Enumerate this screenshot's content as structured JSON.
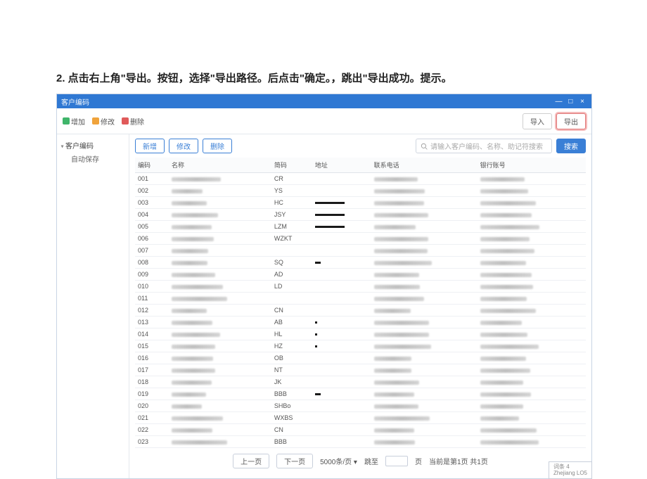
{
  "instruction": "2. 点击右上角\"导出。按钮，选择\"导出路径。后点击\"确定。，跳出\"导出成功。提示。",
  "titlebar": {
    "title": "客户编码"
  },
  "windowControls": {
    "min": "—",
    "max": "□",
    "close": "×"
  },
  "topOps": {
    "add": "增加",
    "edit": "修改",
    "delete": "删除"
  },
  "headerBtns": {
    "import": "导入",
    "export": "导出"
  },
  "sidebar": {
    "parent": "客户编码",
    "child": "自动保存"
  },
  "actions": {
    "add": "新增",
    "edit": "修改",
    "delete": "删除"
  },
  "search": {
    "placeholder": "请输入客户编码、名称、助记符搜索",
    "button": "搜索"
  },
  "headers": [
    "编码",
    "名称",
    "简码",
    "地址",
    "联系电话",
    "银行账号"
  ],
  "rows": [
    {
      "code": "001",
      "abbr": "CR",
      "addrBar": "",
      "extra": ""
    },
    {
      "code": "002",
      "abbr": "YS",
      "addrBar": "",
      "extra": ""
    },
    {
      "code": "003",
      "abbr": "HC",
      "addrBar": "dark",
      "extra": ""
    },
    {
      "code": "004",
      "abbr": "JSY",
      "addrBar": "dark",
      "extra": ""
    },
    {
      "code": "005",
      "abbr": "LZM",
      "addrBar": "dark",
      "extra": ""
    },
    {
      "code": "006",
      "abbr": "WZKT",
      "addrBar": "",
      "extra": ""
    },
    {
      "code": "007",
      "abbr": "",
      "addrBar": "",
      "extra": ""
    },
    {
      "code": "008",
      "abbr": "SQ",
      "addrBar": "tiny",
      "extra": ""
    },
    {
      "code": "009",
      "abbr": "AD",
      "addrBar": "",
      "extra": ""
    },
    {
      "code": "010",
      "abbr": "LD",
      "addrBar": "",
      "extra": ""
    },
    {
      "code": "011",
      "abbr": "",
      "addrBar": "",
      "extra": ""
    },
    {
      "code": "012",
      "abbr": "CN",
      "addrBar": "",
      "extra": ""
    },
    {
      "code": "013",
      "abbr": "AB",
      "addrBar": "dot",
      "extra": ""
    },
    {
      "code": "014",
      "abbr": "HL",
      "addrBar": "dot",
      "extra": ""
    },
    {
      "code": "015",
      "abbr": "HZ",
      "addrBar": "dot",
      "extra": ""
    },
    {
      "code": "016",
      "abbr": "OB",
      "addrBar": "",
      "extra": ""
    },
    {
      "code": "017",
      "abbr": "NT",
      "addrBar": "",
      "extra": ""
    },
    {
      "code": "018",
      "abbr": "JK",
      "addrBar": "",
      "extra": ""
    },
    {
      "code": "019",
      "abbr": "BBB",
      "addrBar": "tiny",
      "extra": ""
    },
    {
      "code": "020",
      "abbr": "SHBo",
      "addrBar": "",
      "extra": ""
    },
    {
      "code": "021",
      "abbr": "WXBS",
      "addrBar": "",
      "extra": ""
    },
    {
      "code": "022",
      "abbr": "CN",
      "addrBar": "",
      "extra": ""
    },
    {
      "code": "023",
      "abbr": "BBB",
      "addrBar": "",
      "extra": ""
    }
  ],
  "pager": {
    "prev": "上一页",
    "next": "下一页",
    "perPage": "5000条/页 ▾",
    "jumpLabel": "跳至",
    "pageUnit": "页",
    "status": "当前是第1页 共1页"
  },
  "footer": {
    "line1": "词条 4",
    "line2": "Zhejiang LO5"
  }
}
